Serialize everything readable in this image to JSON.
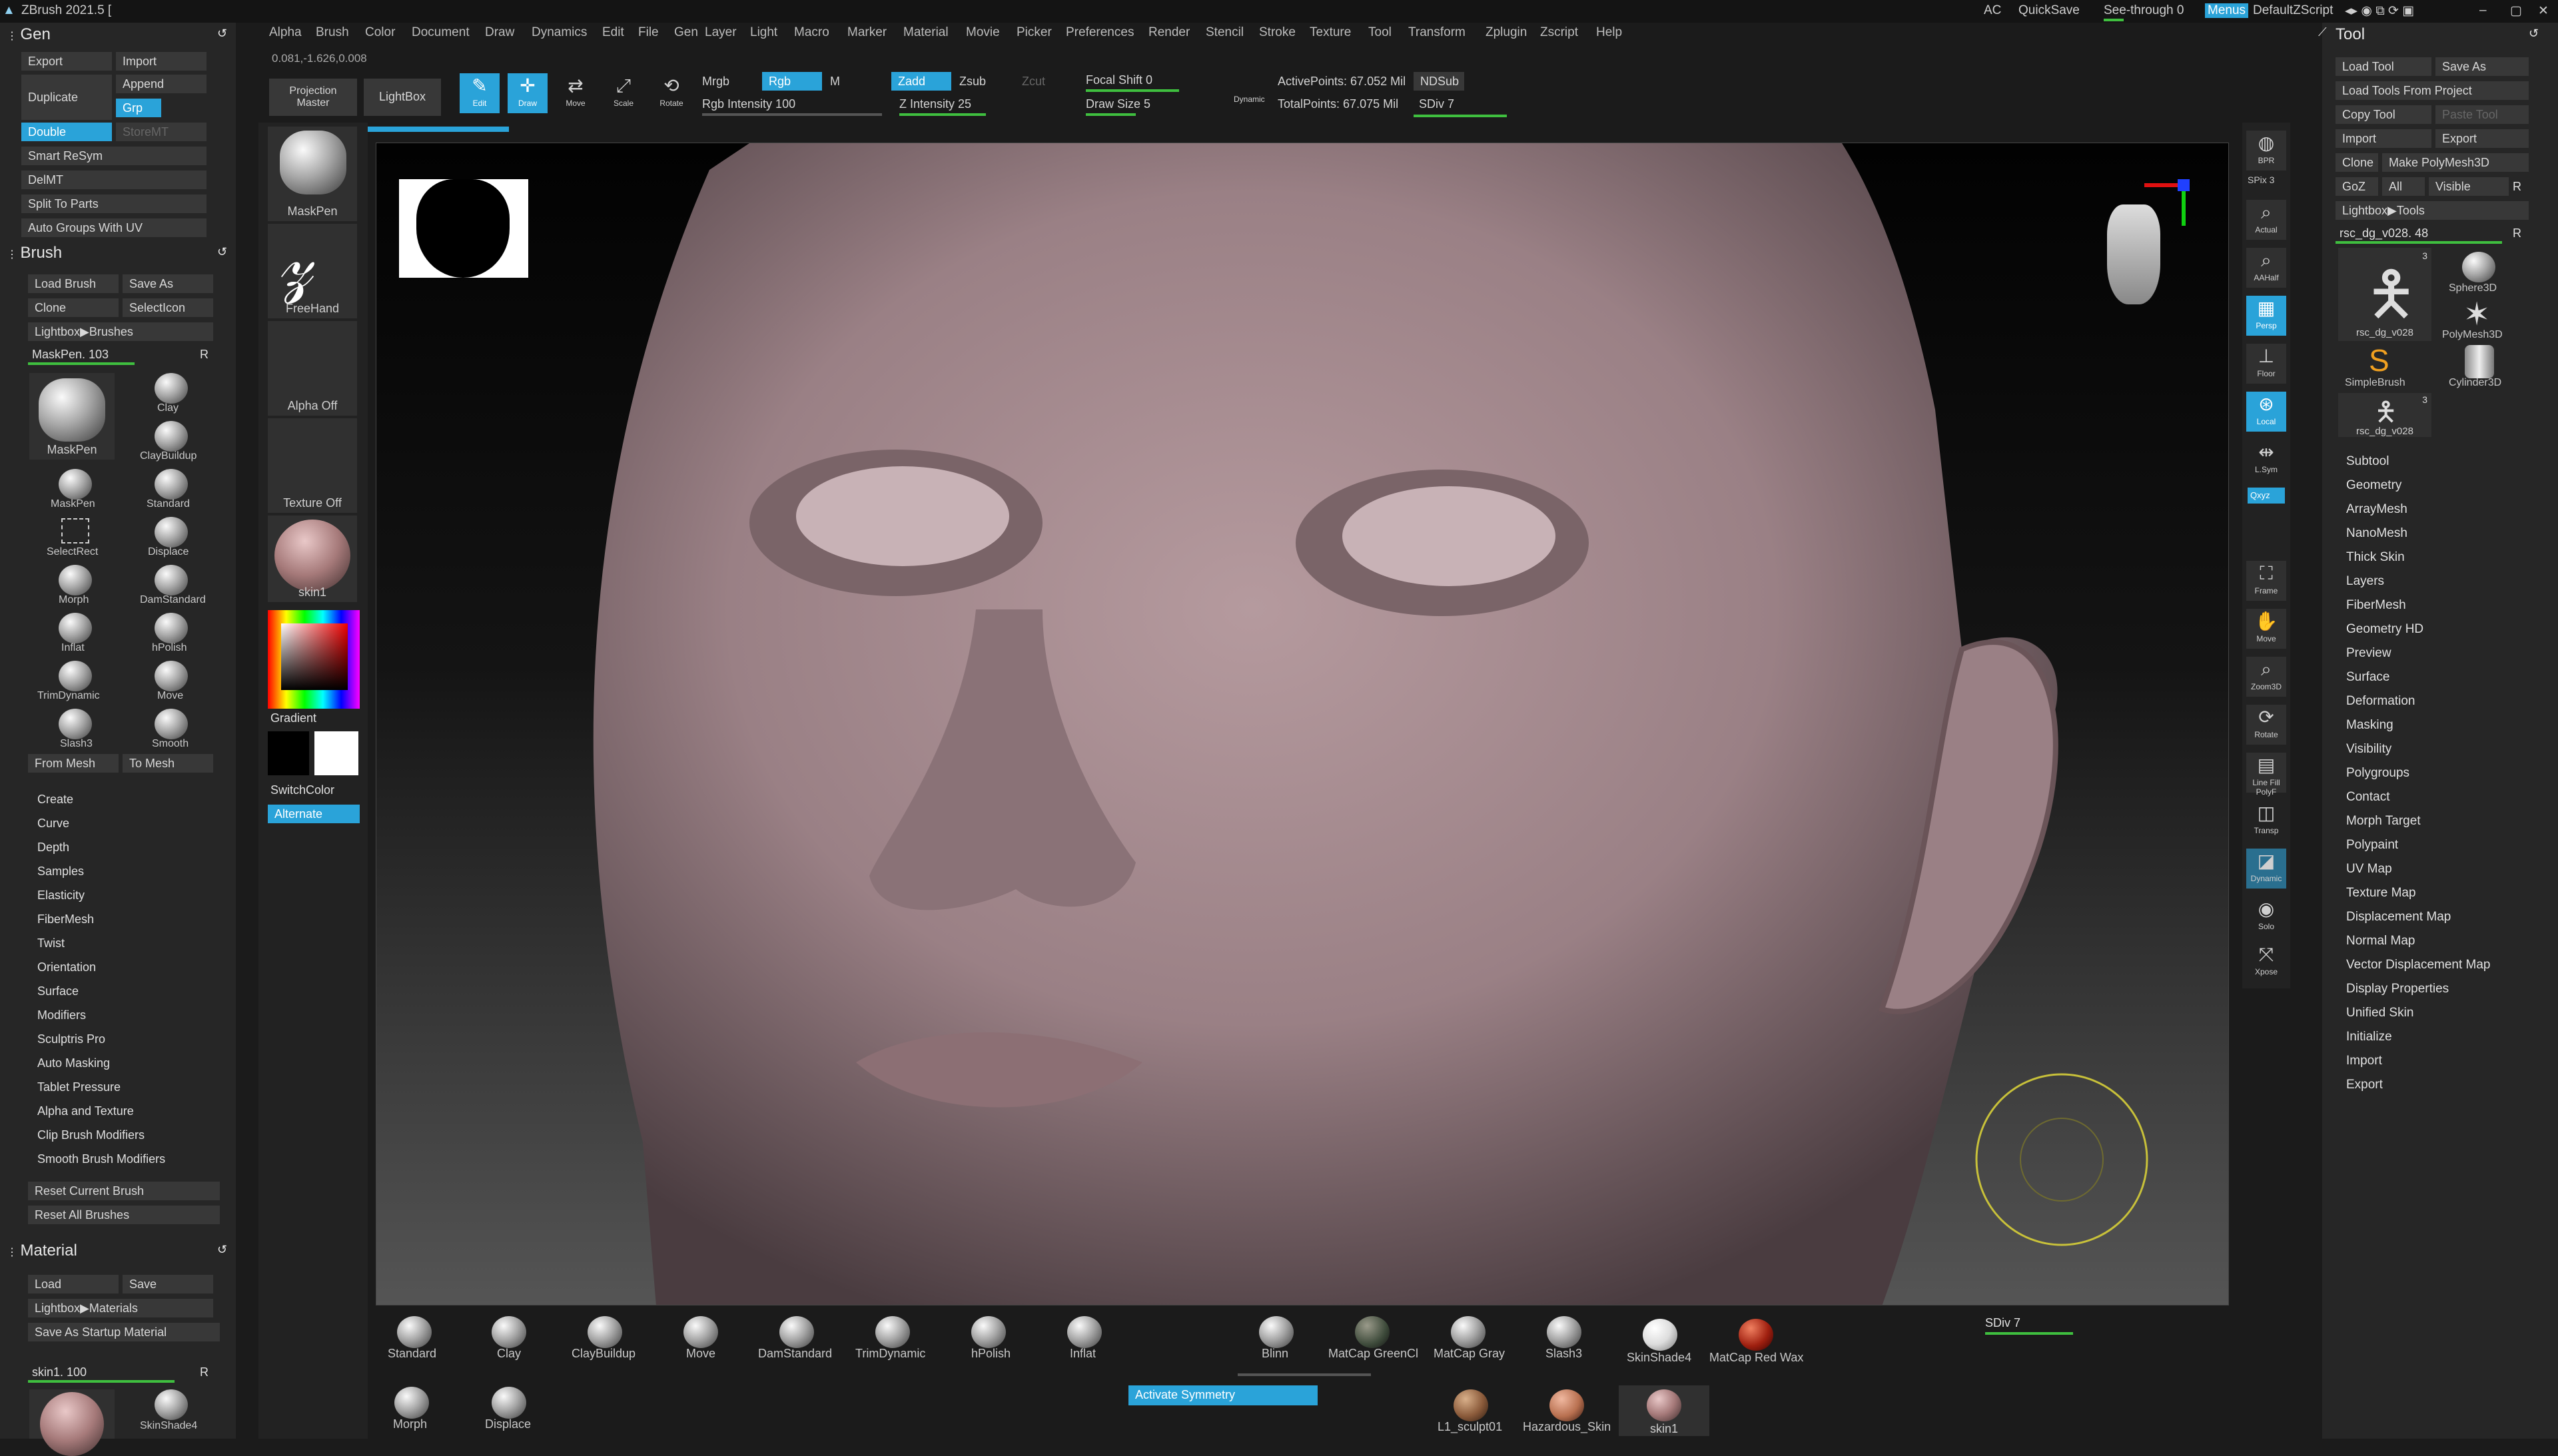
{
  "titlebar": {
    "app_title": "ZBrush 2021.5 [",
    "ac": "AC",
    "quicksave": "QuickSave",
    "see_through": "See-through  0",
    "menus": "Menus",
    "script": "DefaultZScript"
  },
  "menubar": [
    "Alpha",
    "Brush",
    "Color",
    "Document",
    "Draw",
    "Dynamics",
    "Edit",
    "File",
    "Gen",
    "Layer",
    "Light",
    "Macro",
    "Marker",
    "Material",
    "Movie",
    "Picker",
    "Preferences",
    "Render",
    "Stencil",
    "Stroke",
    "Texture",
    "Tool",
    "Transform",
    "Zplugin",
    "Zscript",
    "Help"
  ],
  "coords": "0.081,-1.626,0.008",
  "toolbar": {
    "projection_master": "Projection Master",
    "lightbox": "LightBox",
    "edit": "Edit",
    "draw": "Draw",
    "move": "Move",
    "scale": "Scale",
    "rotate": "Rotate",
    "mrgb": "Mrgb",
    "rgb": "Rgb",
    "m": "M",
    "rgb_intensity": "Rgb Intensity 100",
    "zadd": "Zadd",
    "zsub": "Zsub",
    "zcut": "Zcut",
    "z_intensity": "Z Intensity 25",
    "focal_shift": "Focal Shift 0",
    "draw_size": "Draw Size 5",
    "dynamic": "Dynamic",
    "active_points": "ActivePoints: 67.052 Mil",
    "total_points": "TotalPoints: 67.075 Mil",
    "ndsub": "NDSub",
    "sdiv": "SDiv 7"
  },
  "gen": {
    "header": "Gen",
    "export": "Export",
    "import": "Import",
    "append": "Append",
    "duplicate": "Duplicate",
    "grp": "Grp",
    "double": "Double",
    "storemt": "StoreMT",
    "smart_resym": "Smart ReSym",
    "delmt": "DelMT",
    "split_to_parts": "Split To Parts",
    "auto_groups": "Auto Groups With UV"
  },
  "brush": {
    "header": "Brush",
    "load_brush": "Load Brush",
    "save_as": "Save As",
    "clone": "Clone",
    "select_icon": "SelectIcon",
    "lightbox_brushes": "Lightbox▶Brushes",
    "current": "MaskPen. 103",
    "r": "R",
    "grid": [
      "MaskPen",
      "Clay",
      "ClayBuildup",
      "MaskPen",
      "Standard",
      "SelectRect",
      "Displace",
      "Morph",
      "DamStandard",
      "Inflat",
      "hPolish",
      "TrimDynamic",
      "Move",
      "Slash3",
      "Smooth"
    ],
    "from_mesh": "From Mesh",
    "to_mesh": "To Mesh",
    "sections": [
      "Create",
      "Curve",
      "Depth",
      "Samples",
      "Elasticity",
      "FiberMesh",
      "Twist",
      "Orientation",
      "Surface",
      "Modifiers",
      "Sculptris Pro",
      "Auto Masking",
      "Tablet Pressure",
      "Alpha and Texture",
      "Clip Brush Modifiers",
      "Smooth Brush Modifiers"
    ],
    "reset_current": "Reset Current Brush",
    "reset_all": "Reset All Brushes"
  },
  "material": {
    "header": "Material",
    "load": "Load",
    "save": "Save",
    "lightbox_materials": "Lightbox▶Materials",
    "save_startup": "Save As Startup Material",
    "current": "skin1. 100",
    "r": "R",
    "skinshade": "SkinShade4"
  },
  "left_shelf": {
    "maskpen": "MaskPen",
    "freehand": "FreeHand",
    "alpha_off": "Alpha Off",
    "texture_off": "Texture Off",
    "skin1": "skin1",
    "gradient": "Gradient",
    "switchcolor": "SwitchColor",
    "alternate": "Alternate"
  },
  "right_shelf": [
    "BPR",
    "SPix 3",
    "Actual",
    "AAHalf",
    "Persp",
    "Floor",
    "Local",
    "L.Sym",
    "Qxyz",
    "Frame",
    "Move",
    "Zoom3D",
    "Rotate",
    "Line Fill PolyF",
    "Transp",
    "Dynamic",
    "Solo",
    "Xpose"
  ],
  "tool": {
    "header": "Tool",
    "load_tool": "Load Tool",
    "save_as": "Save As",
    "load_from_project": "Load Tools From Project",
    "copy_tool": "Copy Tool",
    "paste_tool": "Paste Tool",
    "import": "Import",
    "export": "Export",
    "clone": "Clone",
    "make_polymesh": "Make PolyMesh3D",
    "goz": "GoZ",
    "all": "All",
    "visible": "Visible",
    "r": "R",
    "lightbox_tools": "Lightbox▶Tools",
    "current": "rsc_dg_v028. 48",
    "thumbs": [
      "rsc_dg_v028",
      "Sphere3D",
      "PolyMesh3D",
      "SimpleBrush",
      "Cylinder3D",
      "rsc_dg_v028"
    ],
    "thumb_count": "3",
    "menu": [
      "Subtool",
      "Geometry",
      "ArrayMesh",
      "NanoMesh",
      "Thick Skin",
      "Layers",
      "FiberMesh",
      "Geometry HD",
      "Preview",
      "Surface",
      "Deformation",
      "Masking",
      "Visibility",
      "Polygroups",
      "Contact",
      "Morph Target",
      "Polypaint",
      "UV Map",
      "Texture Map",
      "Displacement Map",
      "Normal Map",
      "Vector Displacement Map",
      "Display Properties",
      "Unified Skin",
      "Initialize",
      "Import",
      "Export"
    ]
  },
  "bottom": {
    "brushes": [
      "Standard",
      "Clay",
      "ClayBuildup",
      "Move",
      "DamStandard",
      "TrimDynamic",
      "hPolish",
      "Inflat",
      "Morph",
      "Displace"
    ],
    "materials": [
      "Blinn",
      "MatCap GreenCl",
      "MatCap Gray",
      "Slash3",
      "SkinShade4",
      "MatCap Red Wax",
      "L1_sculpt01",
      "Hazardous_Skin",
      "skin1"
    ],
    "activate_symmetry": "Activate Symmetry",
    "sdiv": "SDiv 7"
  },
  "colors": {
    "accent": "#2aa3d9",
    "slider": "#3fbf3f",
    "panel": "#262626",
    "gizmo": "#c8c13a"
  }
}
